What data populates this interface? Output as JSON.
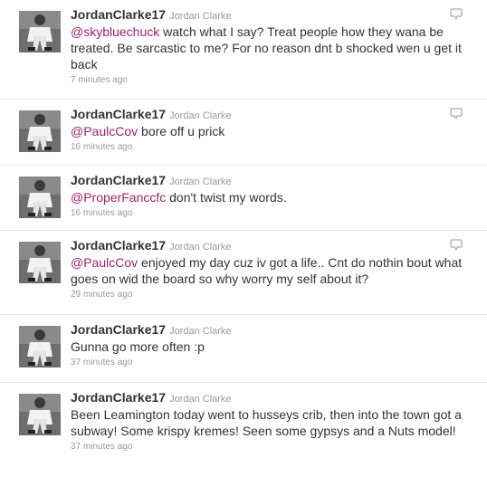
{
  "tweets": [
    {
      "screen_name": "JordanClarke17",
      "full_name": "Jordan Clarke",
      "mention": "@skybluechuck",
      "text": " watch what I say? Treat people how they wana be treated. Be sarcastic to me? For no reason dnt b shocked wen u get it back",
      "timestamp": "7 minutes ago"
    },
    {
      "screen_name": "JordanClarke17",
      "full_name": "Jordan Clarke",
      "mention": "@PaulcCov",
      "text": " bore off u prick",
      "timestamp": "16 minutes ago"
    },
    {
      "screen_name": "JordanClarke17",
      "full_name": "Jordan Clarke",
      "mention": "@ProperFanccfc",
      "text": " don't twist my words.",
      "timestamp": "16 minutes ago"
    },
    {
      "screen_name": "JordanClarke17",
      "full_name": "Jordan Clarke",
      "mention": "@PaulcCov",
      "text": " enjoyed my day cuz iv got a life.. Cnt do nothin bout what goes on wid the board so why worry my self about it?",
      "timestamp": "29 minutes ago"
    },
    {
      "screen_name": "JordanClarke17",
      "full_name": "Jordan Clarke",
      "mention": "",
      "text": "Gunna go more often :p",
      "timestamp": "37 minutes ago"
    },
    {
      "screen_name": "JordanClarke17",
      "full_name": "Jordan Clarke",
      "mention": "",
      "text": "Been Leamington today went to husseys crib, then into the town got a subway! Some krispy kremes! Seen some gypsys and a Nuts model!",
      "timestamp": "37 minutes ago"
    }
  ],
  "colors": {
    "mention": "#a0226b",
    "name": "#333333",
    "meta": "#999999"
  },
  "icons": {
    "reply": "reply-icon",
    "avatar": "avatar"
  }
}
